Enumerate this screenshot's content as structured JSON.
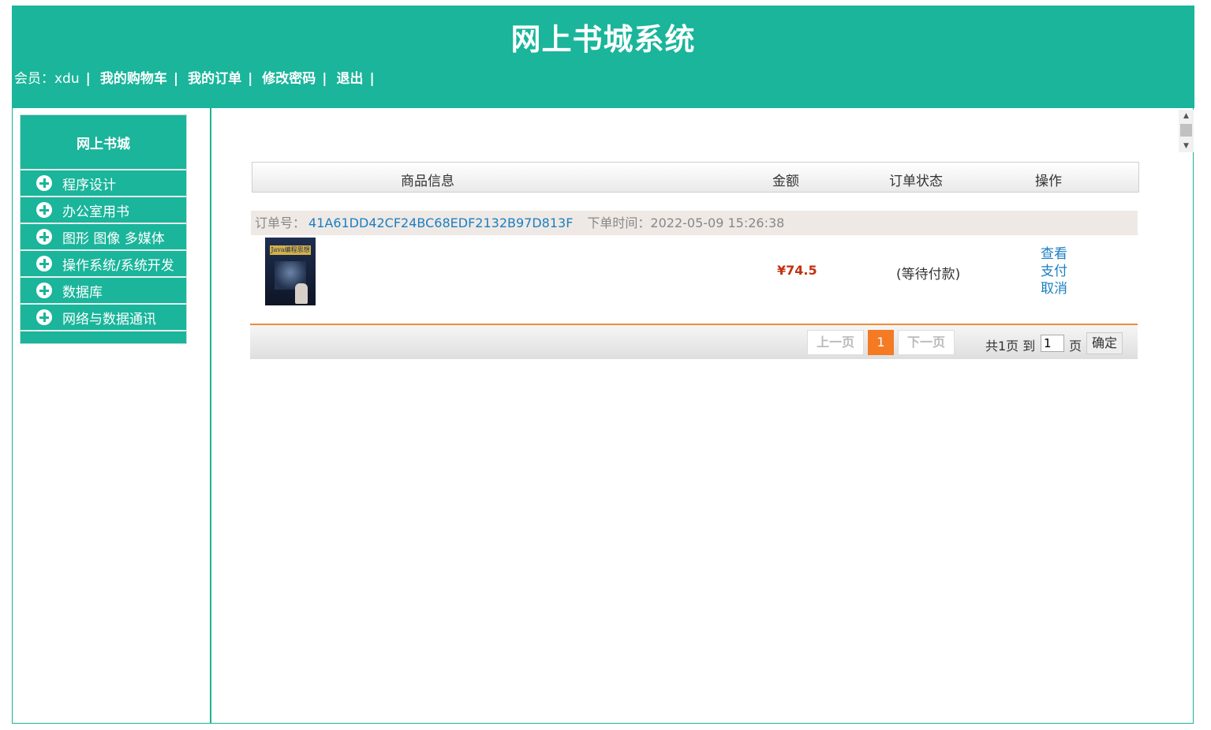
{
  "header": {
    "title": "网上书城系统",
    "member_label": "会员：xdu",
    "separator": "|",
    "nav_links": [
      "我的购物车",
      "我的订单",
      "修改密码",
      "退出"
    ]
  },
  "sidebar": {
    "title": "网上书城",
    "items": [
      {
        "label": "程序设计"
      },
      {
        "label": "办公室用书"
      },
      {
        "label": "图形 图像 多媒体"
      },
      {
        "label": "操作系统/系统开发"
      },
      {
        "label": "数据库"
      },
      {
        "label": "网络与数据通讯"
      }
    ]
  },
  "table": {
    "headers": [
      "商品信息",
      "金额",
      "订单状态",
      "操作"
    ]
  },
  "order": {
    "id_label": "订单号：",
    "id": "41A61DD42CF24BC68EDF2132B97D813F",
    "time_label": "下单时间：",
    "time": "2022-05-09 15:26:38",
    "book_cover_text": "Java编程思想",
    "amount": "¥74.5",
    "status": "(等待付款)",
    "actions": [
      "查看",
      "支付",
      "取消"
    ]
  },
  "pager": {
    "prev_label": "上一页",
    "current_page": "1",
    "next_label": "下一页",
    "total_text": "共1页 到",
    "input_value": "1",
    "page_unit": "页",
    "confirm_label": "确定"
  },
  "colors": {
    "brand": "#1ab59b",
    "accent": "#f47a24",
    "link": "#1a7fc1",
    "price": "#c33010"
  }
}
